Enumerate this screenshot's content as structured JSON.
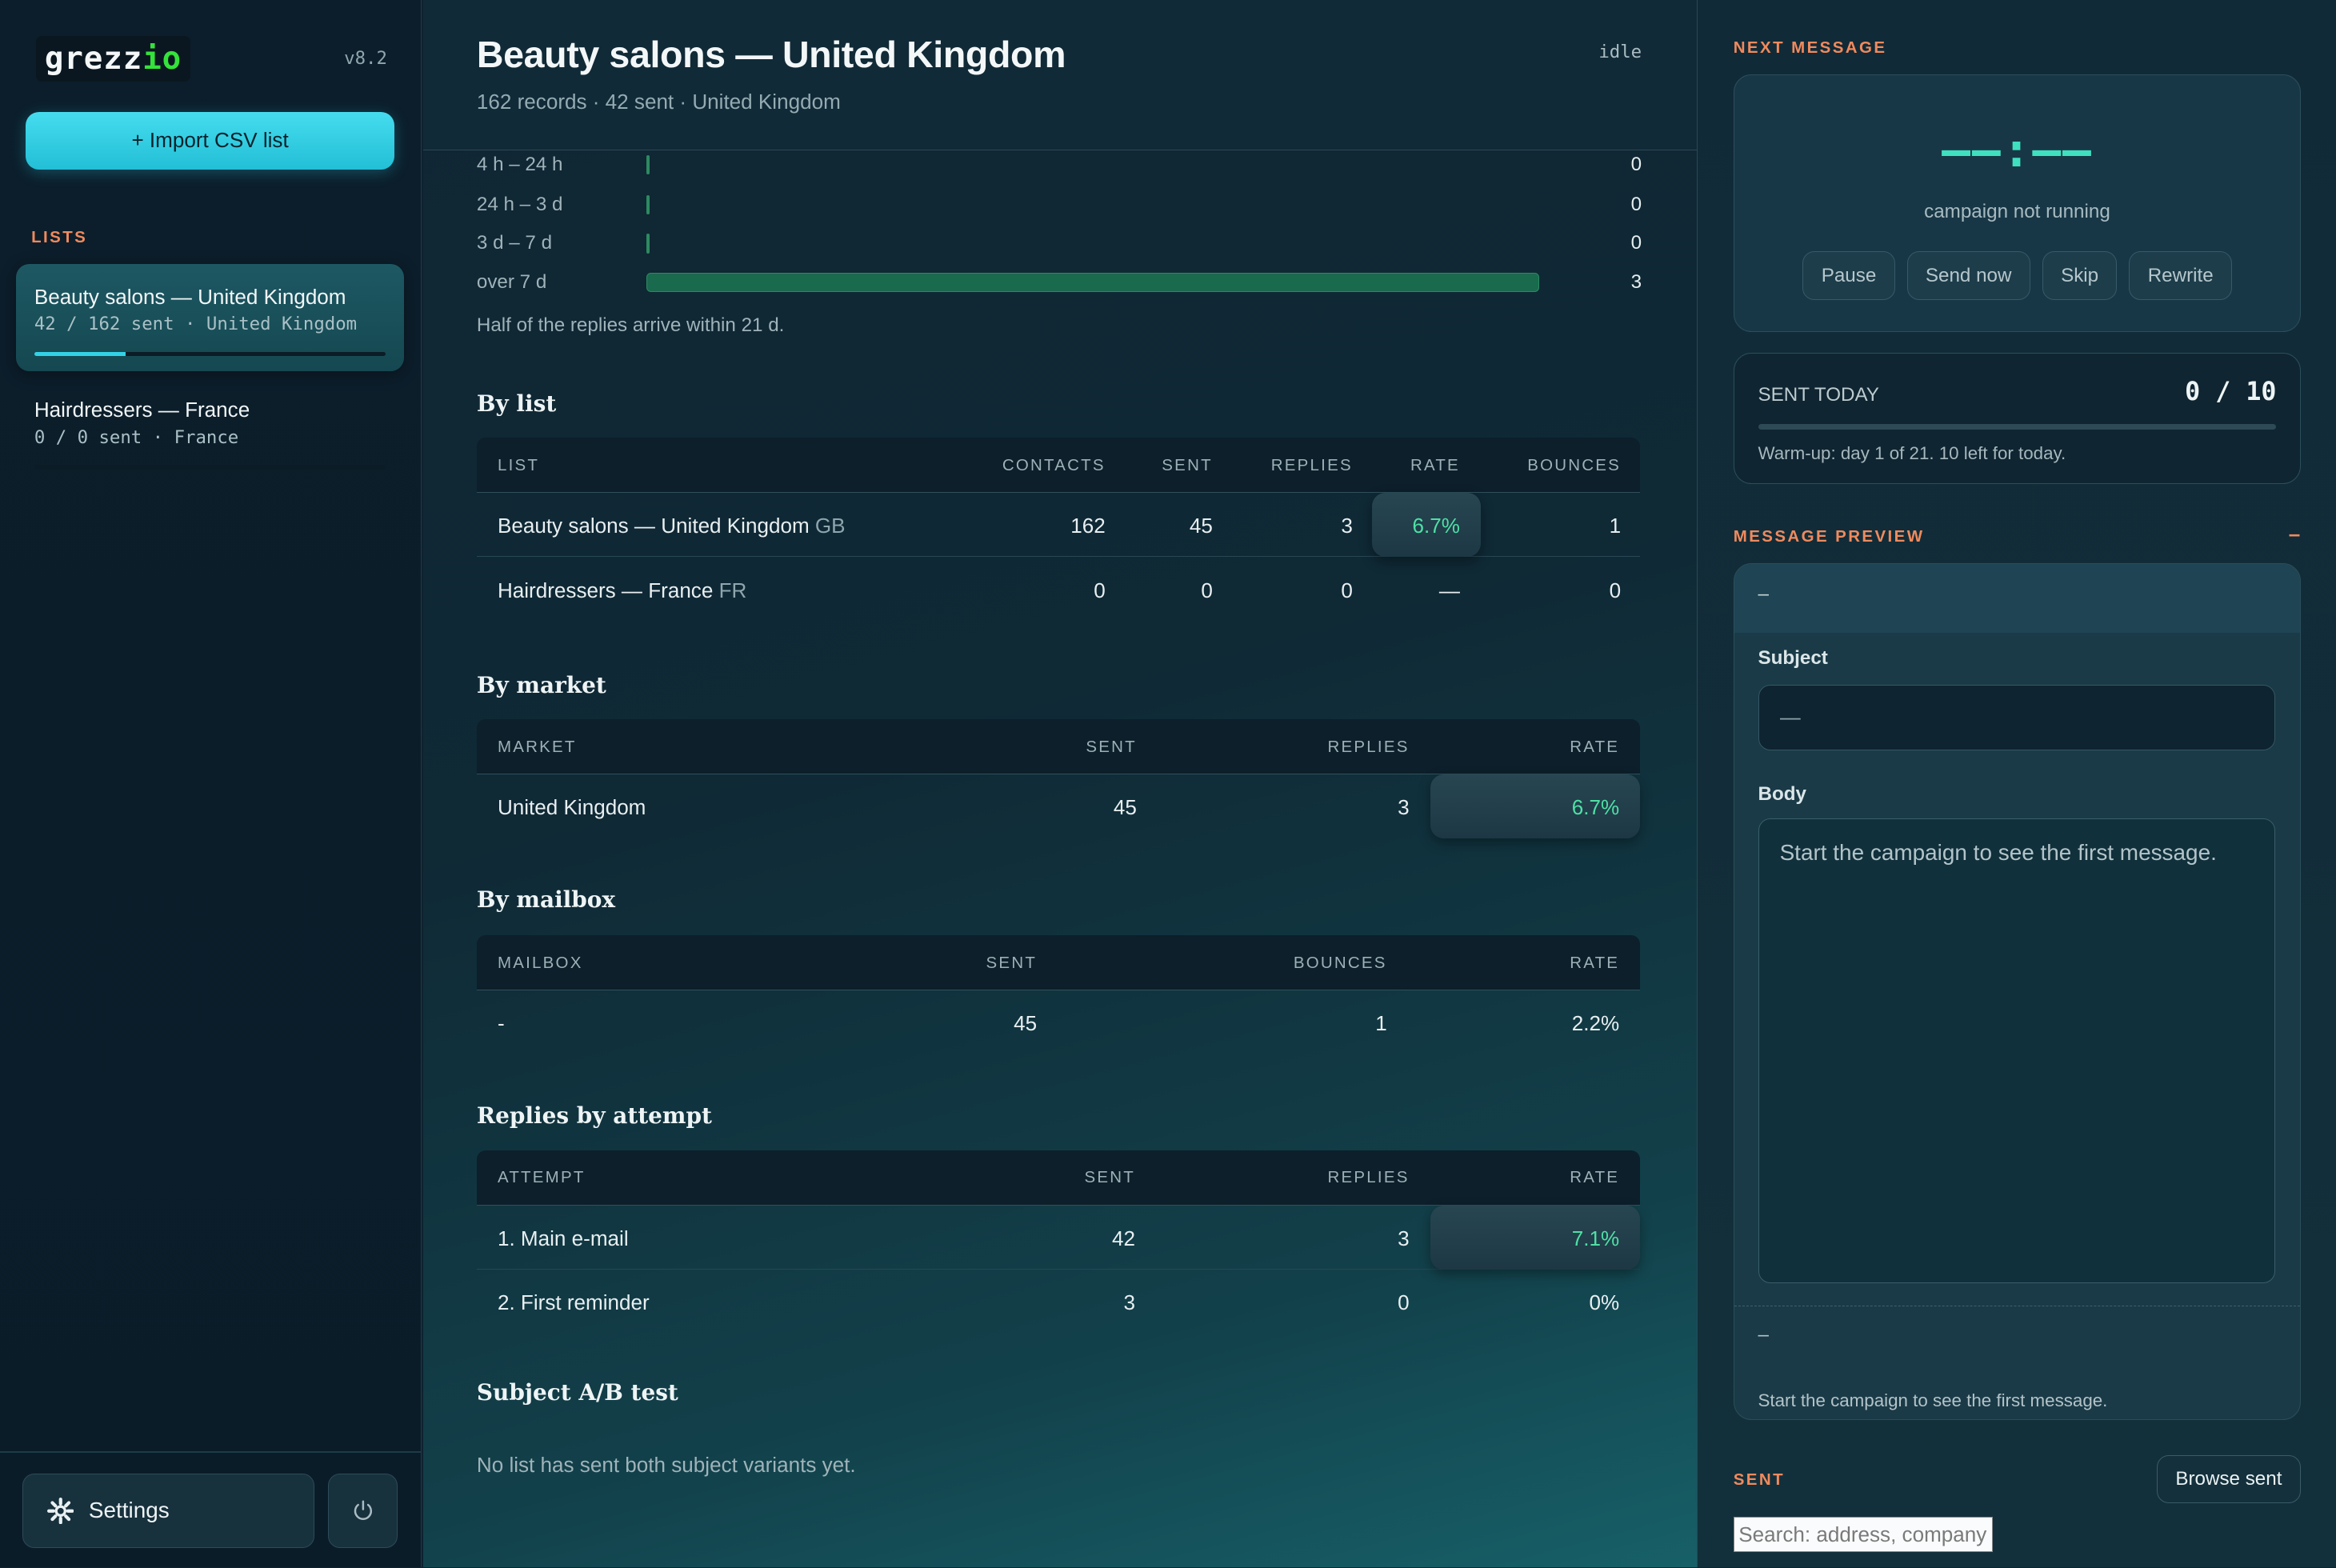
{
  "sidebar": {
    "logo_main": "grezz",
    "logo_accent": "io",
    "version": "v8.2",
    "import_label": "+ Import CSV list",
    "lists_label": "LISTS",
    "lists": [
      {
        "title": "Beauty salons — United Kingdom",
        "meta": "42 / 162 sent · United Kingdom",
        "progress": 0.26,
        "active": true
      },
      {
        "title": "Hairdressers — France",
        "meta": "0 / 0 sent · France",
        "progress": 0,
        "active": false
      }
    ],
    "settings_label": "Settings"
  },
  "header": {
    "title": "Beauty salons — United Kingdom",
    "subtitle": "162 records · 42 sent · United Kingdom",
    "status": "idle"
  },
  "histogram": {
    "rows": [
      {
        "label": "4 h – 24 h",
        "value": "0",
        "count": 0
      },
      {
        "label": "24 h – 3 d",
        "value": "0",
        "count": 0
      },
      {
        "label": "3 d – 7 d",
        "value": "0",
        "count": 0
      },
      {
        "label": "over 7 d",
        "value": "3",
        "count": 3
      }
    ],
    "max": 3,
    "note": "Half of the replies arrive within 21 d."
  },
  "by_list": {
    "title": "By list",
    "columns": [
      "LIST",
      "CONTACTS",
      "SENT",
      "REPLIES",
      "RATE",
      "BOUNCES"
    ],
    "rows": [
      {
        "list": "Beauty salons — United Kingdom",
        "cc": "GB",
        "contacts": "162",
        "sent": "45",
        "replies": "3",
        "rate": "6.7%",
        "bounces": "1"
      },
      {
        "list": "Hairdressers — France",
        "cc": "FR",
        "contacts": "0",
        "sent": "0",
        "replies": "0",
        "rate": "—",
        "bounces": "0"
      }
    ]
  },
  "by_market": {
    "title": "By market",
    "columns": [
      "MARKET",
      "SENT",
      "REPLIES",
      "RATE"
    ],
    "rows": [
      {
        "market": "United Kingdom",
        "sent": "45",
        "replies": "3",
        "rate": "6.7%"
      }
    ]
  },
  "by_mailbox": {
    "title": "By mailbox",
    "columns": [
      "MAILBOX",
      "SENT",
      "BOUNCES",
      "RATE"
    ],
    "rows": [
      {
        "mailbox": "-",
        "sent": "45",
        "bounces": "1",
        "rate": "2.2%"
      }
    ]
  },
  "by_attempt": {
    "title": "Replies by attempt",
    "columns": [
      "ATTEMPT",
      "SENT",
      "REPLIES",
      "RATE"
    ],
    "rows": [
      {
        "attempt": "1. Main e-mail",
        "sent": "42",
        "replies": "3",
        "rate": "7.1%"
      },
      {
        "attempt": "2. First reminder",
        "sent": "3",
        "replies": "0",
        "rate": "0%"
      }
    ]
  },
  "ab_test": {
    "title": "Subject A/B test",
    "note": "No list has sent both subject variants yet."
  },
  "next_message": {
    "label": "NEXT MESSAGE",
    "timer": "––:––",
    "status": "campaign not running",
    "buttons": [
      "Pause",
      "Send now",
      "Skip",
      "Rewrite"
    ]
  },
  "sent_today": {
    "label": "SENT TODAY",
    "count": "0 / 10",
    "progress": 0,
    "note": "Warm-up: day 1 of 21. 10 left for today."
  },
  "preview": {
    "label": "MESSAGE PREVIEW",
    "collapse": "–",
    "header": "–",
    "subject_label": "Subject",
    "subject_value": "—",
    "body_label": "Body",
    "body_value": "Start the campaign to see the first message.",
    "footer_dash": "–",
    "footer_text": "Start the campaign to see the first message."
  },
  "sent_section": {
    "label": "SENT",
    "browse_label": "Browse sent",
    "search_placeholder": "Search: address, company"
  },
  "colors": {
    "accent_cyan": "#33d3e6",
    "accent_orange": "#f08a5d",
    "rate_green": "#4fe0a5",
    "logo_green": "#35e23b"
  }
}
